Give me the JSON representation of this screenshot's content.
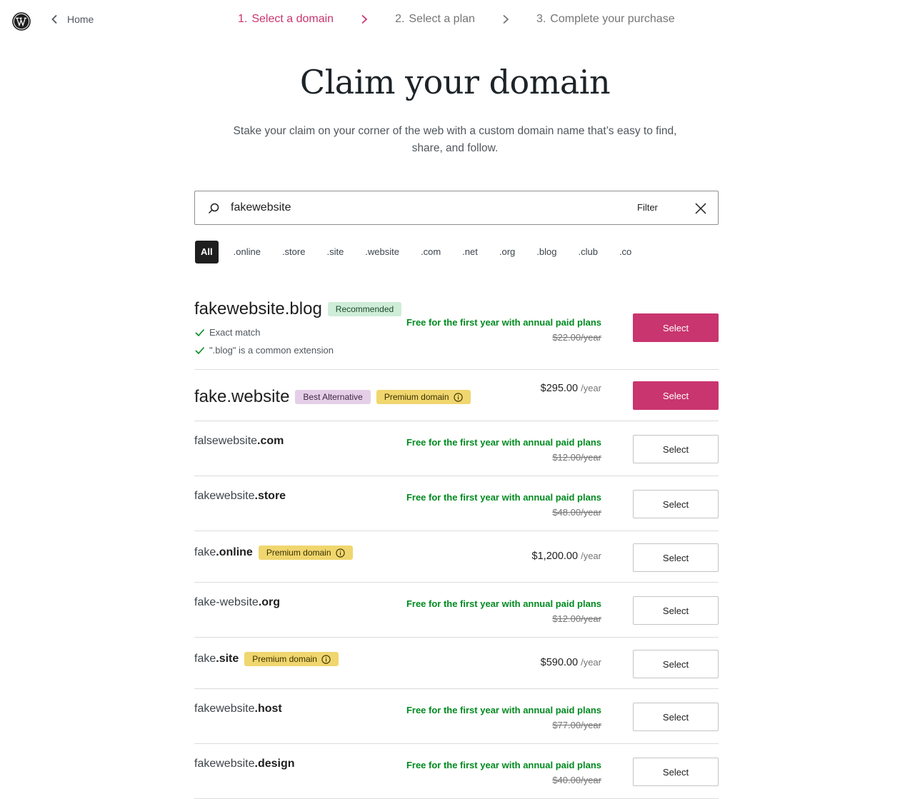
{
  "header": {
    "home_label": "Home",
    "steps": [
      {
        "num": "1.",
        "label": "Select a domain",
        "active": true
      },
      {
        "num": "2.",
        "label": "Select a plan",
        "active": false
      },
      {
        "num": "3.",
        "label": "Complete your purchase",
        "active": false
      }
    ]
  },
  "hero": {
    "title": "Claim your domain",
    "subtitle": "Stake your claim on your corner of the web with a custom domain name that’s easy to find, share, and follow."
  },
  "search": {
    "value": "fakewebsite",
    "filter_label": "Filter"
  },
  "tld_filters": [
    "All",
    ".online",
    ".store",
    ".site",
    ".website",
    ".com",
    ".net",
    ".org",
    ".blog",
    ".club",
    ".co"
  ],
  "results": [
    {
      "name": "fakewebsite",
      "tld": ".blog",
      "featured": true,
      "badges": [
        {
          "type": "rec",
          "label": "Recommended"
        }
      ],
      "checks": [
        "Exact match",
        "\".blog\" is a common extension"
      ],
      "free_text": "Free for the first year with annual paid plans",
      "original_price": "$22.00/year",
      "button": "Select"
    },
    {
      "name": "fake",
      "tld": ".website",
      "featured": true,
      "badges": [
        {
          "type": "alt",
          "label": "Best Alternative"
        },
        {
          "type": "prem",
          "label": "Premium domain"
        }
      ],
      "price": "$295.00",
      "per": "/year",
      "button": "Select"
    },
    {
      "name": "falsewebsite",
      "tld": ".com",
      "free_text": "Free for the first year with annual paid plans",
      "original_price": "$12.00/year",
      "button": "Select"
    },
    {
      "name": "fakewebsite",
      "tld": ".store",
      "free_text": "Free for the first year with annual paid plans",
      "original_price": "$48.00/year",
      "button": "Select"
    },
    {
      "name": "fake",
      "tld": ".online",
      "badges": [
        {
          "type": "prem",
          "label": "Premium domain"
        }
      ],
      "price": "$1,200.00",
      "per": "/year",
      "button": "Select"
    },
    {
      "name": "fake-website",
      "tld": ".org",
      "free_text": "Free for the first year with annual paid plans",
      "original_price": "$12.00/year",
      "button": "Select"
    },
    {
      "name": "fake",
      "tld": ".site",
      "badges": [
        {
          "type": "prem",
          "label": "Premium domain"
        }
      ],
      "price": "$590.00",
      "per": "/year",
      "button": "Select"
    },
    {
      "name": "fakewebsite",
      "tld": ".host",
      "free_text": "Free for the first year with annual paid plans",
      "original_price": "$77.00/year",
      "button": "Select"
    },
    {
      "name": "fakewebsite",
      "tld": ".design",
      "free_text": "Free for the first year with annual paid plans",
      "original_price": "$40.00/year",
      "button": "Select"
    }
  ],
  "colors": {
    "accent": "#c9356e",
    "free_green": "#008a20"
  }
}
